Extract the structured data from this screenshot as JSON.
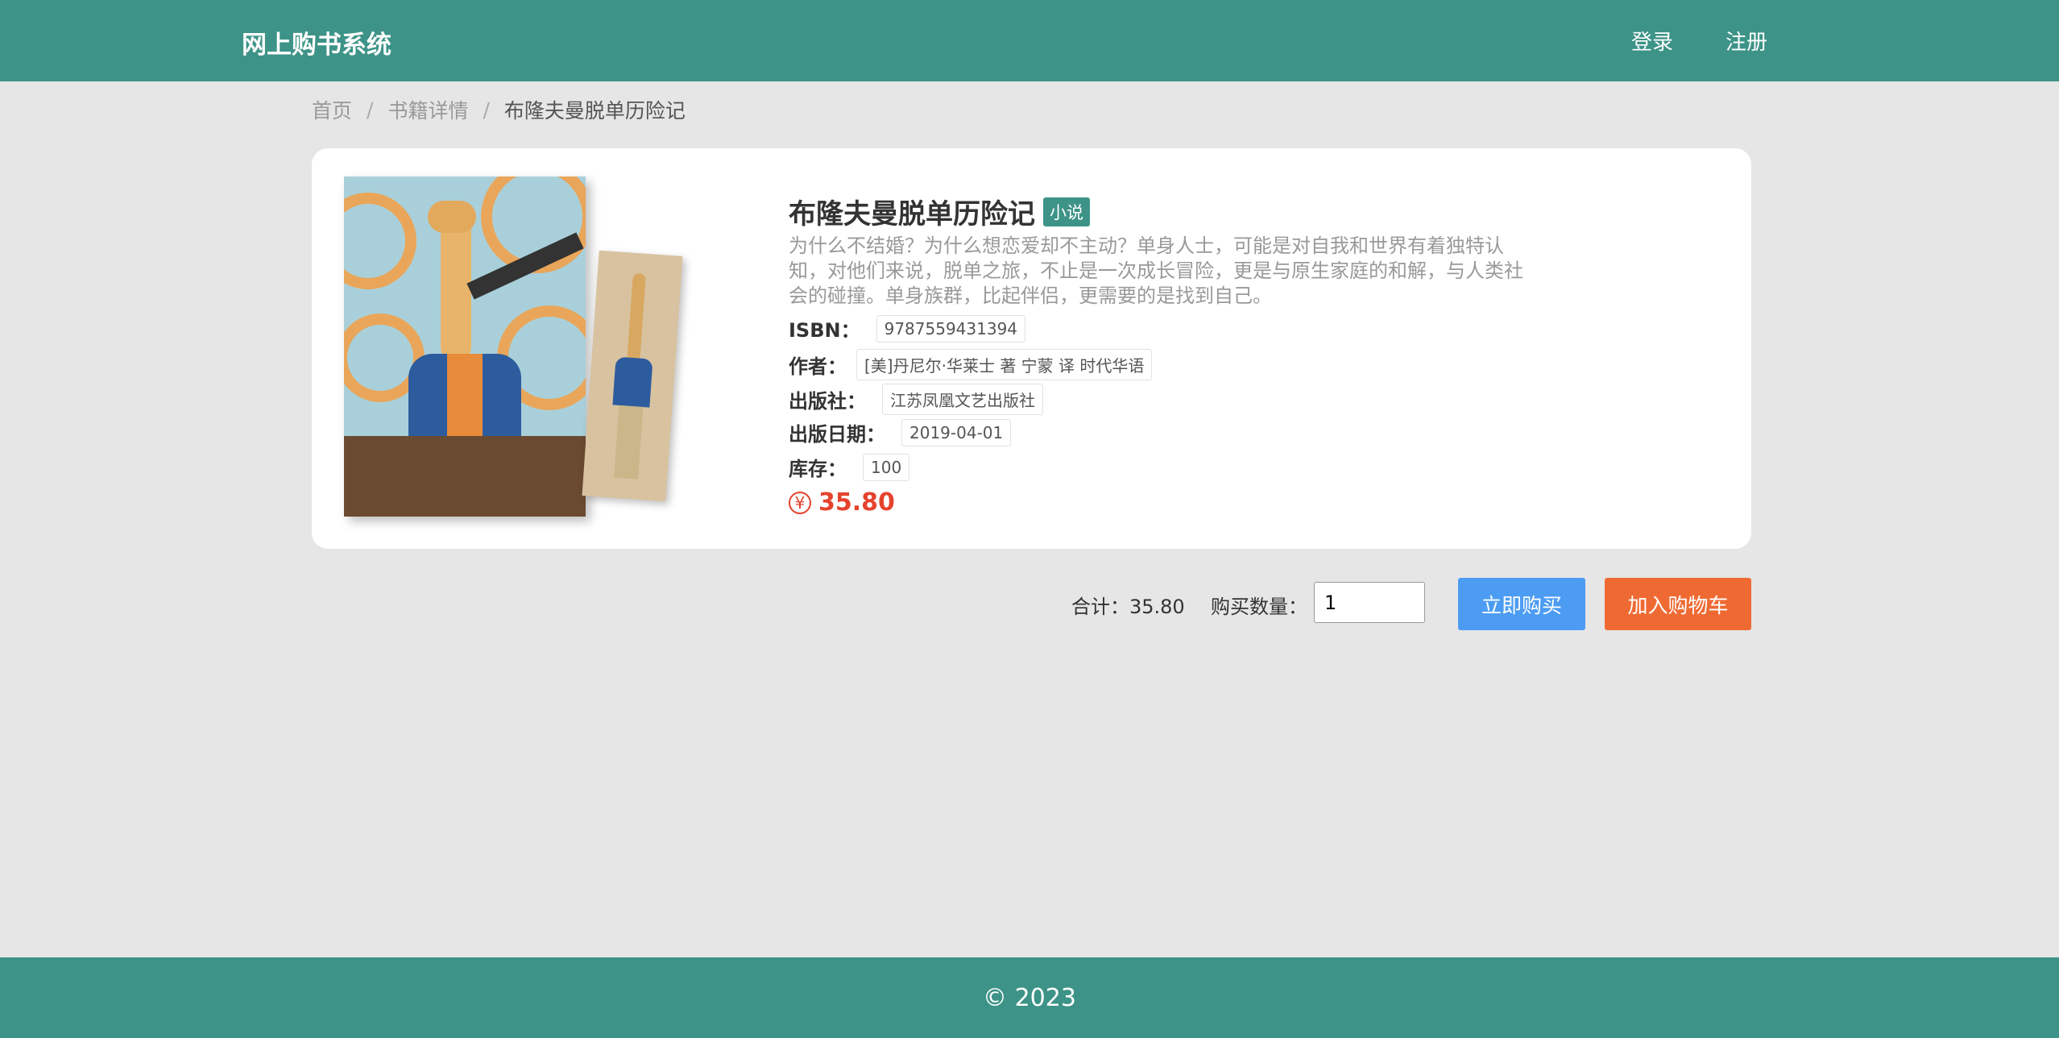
{
  "header": {
    "brand": "网上购书系统",
    "nav": {
      "login": "登录",
      "register": "注册"
    }
  },
  "breadcrumb": {
    "items": [
      "首页",
      "书籍详情",
      "布隆夫曼脱单历险记"
    ],
    "separator": "/"
  },
  "book": {
    "title": "布隆夫曼脱单历险记",
    "category": "小说",
    "description": "为什么不结婚？为什么想恋爱却不主动？单身人士，可能是对自我和世界有着独特认知，对他们来说，脱单之旅，不止是一次成长冒险，更是与原生家庭的和解，与人类社会的碰撞。单身族群，比起伴侣，更需要的是找到自己。",
    "fields": {
      "isbn": {
        "label": "ISBN：",
        "value": "9787559431394"
      },
      "author": {
        "label": "作者：",
        "value": "[美]丹尼尔·华莱士 著 宁蒙 译 时代华语"
      },
      "publisher": {
        "label": "出版社：",
        "value": "江苏凤凰文艺出版社"
      },
      "pub_date": {
        "label": "出版日期：",
        "value": "2019-04-01"
      },
      "stock": {
        "label": "库存：",
        "value": "100"
      }
    },
    "price_symbol": "¥",
    "price": "35.80",
    "cover_icon": "book-cover-image"
  },
  "purchase": {
    "total_label": "合计：35.80",
    "quantity_label": "购买数量：",
    "quantity_value": "1",
    "buy_now": "立即购买",
    "add_to_cart": "加入购物车"
  },
  "footer": {
    "copyright": "© 2023"
  },
  "colors": {
    "header_bg": "#3d9387",
    "buy_button": "#4c9cf3",
    "cart_button": "#ef6a33",
    "price": "#e5432d"
  }
}
